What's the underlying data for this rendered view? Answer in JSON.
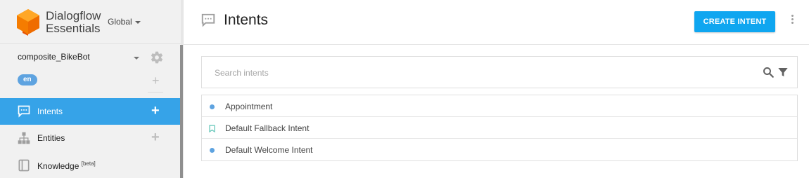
{
  "brand": {
    "line1": "Dialogflow",
    "line2": "Essentials",
    "region": "Global"
  },
  "agent": {
    "name": "composite_BikeBot",
    "language": "en"
  },
  "nav": [
    {
      "label": "Intents",
      "beta": "",
      "icon": "chat-icon",
      "active": true
    },
    {
      "label": "Entities",
      "beta": "",
      "icon": "hierarchy-icon",
      "active": false
    },
    {
      "label": "Knowledge",
      "beta": "[beta]",
      "icon": "book-icon",
      "active": false
    }
  ],
  "header": {
    "title": "Intents",
    "create_label": "CREATE INTENT"
  },
  "search": {
    "placeholder": "Search intents"
  },
  "intents": [
    {
      "name": "Appointment",
      "marker": "dot"
    },
    {
      "name": "Default Fallback Intent",
      "marker": "bookmark"
    },
    {
      "name": "Default Welcome Intent",
      "marker": "dot"
    }
  ],
  "colors": {
    "accent": "#36a3e8",
    "button": "#0fa6f0",
    "logo": "#f57c00",
    "pill": "#5ea3e0"
  }
}
